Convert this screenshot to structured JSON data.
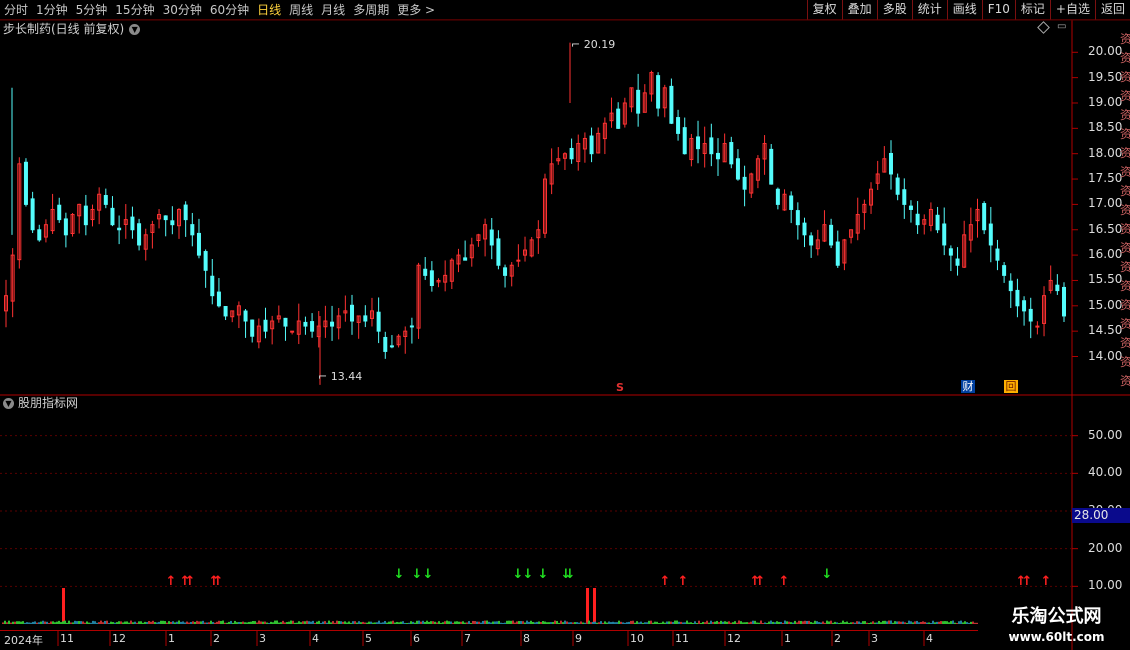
{
  "toolbar": {
    "periods": [
      "分时",
      "1分钟",
      "5分钟",
      "15分钟",
      "30分钟",
      "60分钟",
      "日线",
      "周线",
      "月线",
      "多周期",
      "更多 >"
    ],
    "active_period": "日线",
    "tools": [
      "复权",
      "叠加",
      "多股",
      "统计",
      "画线",
      "F10",
      "标记",
      "+自选",
      "返回"
    ]
  },
  "price_pane": {
    "title": "步长制药(日线 前复权)",
    "high_marker": "20.19",
    "low_marker": "13.44",
    "axis_labels": [
      "20.00",
      "19.50",
      "19.00",
      "18.50",
      "18.00",
      "17.50",
      "17.00",
      "16.50",
      "16.00",
      "15.50",
      "15.00",
      "14.50",
      "14.00"
    ],
    "badges": {
      "s": "S",
      "cai": "财",
      "box": "回"
    }
  },
  "indicator_pane": {
    "title": "股朋指标网",
    "axis_labels": [
      "50.00",
      "40.00",
      "30.00",
      "20.00",
      "10.00"
    ],
    "current_value": "28.00"
  },
  "time_axis": {
    "labels": [
      "2024年",
      "11",
      "12",
      "1",
      "2",
      "3",
      "4",
      "5",
      "6",
      "7",
      "8",
      "9",
      "10",
      "11",
      "12",
      "1",
      "2",
      "3",
      "4"
    ]
  },
  "watermark": {
    "title": "乐淘公式网",
    "url": "www.60lt.com"
  },
  "edge_glyphs": [
    "资",
    "资",
    "资",
    "资",
    "资",
    "资",
    "资",
    "资",
    "资",
    "资",
    "资",
    "资",
    "资",
    "资",
    "资",
    "资",
    "资",
    "资",
    "资"
  ],
  "colors": {
    "up": "#ff3232",
    "down": "#54fcfc",
    "grid": "#3a0000",
    "axis": "#b00000",
    "buy_arrow": "#ff2020",
    "sell_arrow": "#20e020"
  },
  "chart_data": {
    "type": "candlestick",
    "series_closes": [
      15.2,
      16.0,
      17.8,
      17.0,
      16.5,
      16.3,
      16.6,
      16.9,
      16.7,
      16.4,
      16.8,
      17.0,
      16.6,
      16.9,
      17.2,
      17.0,
      16.6,
      16.5,
      16.7,
      16.5,
      16.2,
      16.4,
      16.6,
      16.8,
      16.7,
      16.6,
      16.9,
      16.7,
      16.4,
      16.0,
      15.7,
      15.2,
      15.0,
      14.8,
      14.9,
      15.0,
      14.7,
      14.4,
      14.6,
      14.5,
      14.7,
      14.8,
      14.6,
      14.5,
      14.7,
      14.6,
      14.5,
      14.6,
      14.7,
      14.6,
      14.8,
      14.9,
      14.7,
      14.8,
      14.7,
      14.9,
      14.5,
      14.1,
      14.2,
      14.4,
      14.5,
      14.6,
      15.8,
      15.6,
      15.4,
      15.5,
      15.6,
      15.9,
      16.0,
      15.9,
      16.2,
      16.4,
      16.6,
      16.2,
      15.8,
      15.6,
      15.8,
      15.9,
      16.1,
      16.3,
      16.5,
      17.5,
      17.8,
      17.9,
      18.0,
      17.9,
      18.2,
      18.3,
      18.0,
      18.4,
      18.6,
      18.8,
      18.5,
      19.0,
      19.3,
      18.8,
      19.2,
      19.6,
      18.9,
      19.3,
      18.6,
      18.4,
      18.0,
      18.3,
      18.1,
      18.2,
      18.0,
      17.9,
      18.2,
      17.8,
      17.5,
      17.3,
      17.6,
      17.9,
      18.2,
      17.4,
      17.0,
      17.2,
      16.9,
      16.6,
      16.4,
      16.2,
      16.3,
      16.6,
      16.2,
      15.8,
      16.3,
      16.5,
      16.8,
      17.0,
      17.3,
      17.6,
      17.9,
      17.6,
      17.2,
      17.0,
      16.9,
      16.6,
      16.7,
      16.9,
      16.5,
      16.2,
      16.0,
      15.8,
      16.4,
      16.6,
      16.9,
      16.5,
      16.2,
      15.9,
      15.6,
      15.3,
      15.0,
      14.9,
      14.7,
      14.6,
      15.2,
      15.5,
      15.3,
      14.8
    ],
    "high": 20.19,
    "low": 13.44,
    "ylim": [
      13.3,
      20.4
    ],
    "indicator": {
      "ylim": [
        0,
        60
      ],
      "buy_arrows": [
        1,
        2,
        3,
        4,
        6,
        8,
        9,
        10,
        11,
        12,
        13,
        14
      ],
      "sell_arrows": [
        1,
        2,
        3,
        4,
        5,
        6,
        7,
        8
      ]
    }
  }
}
